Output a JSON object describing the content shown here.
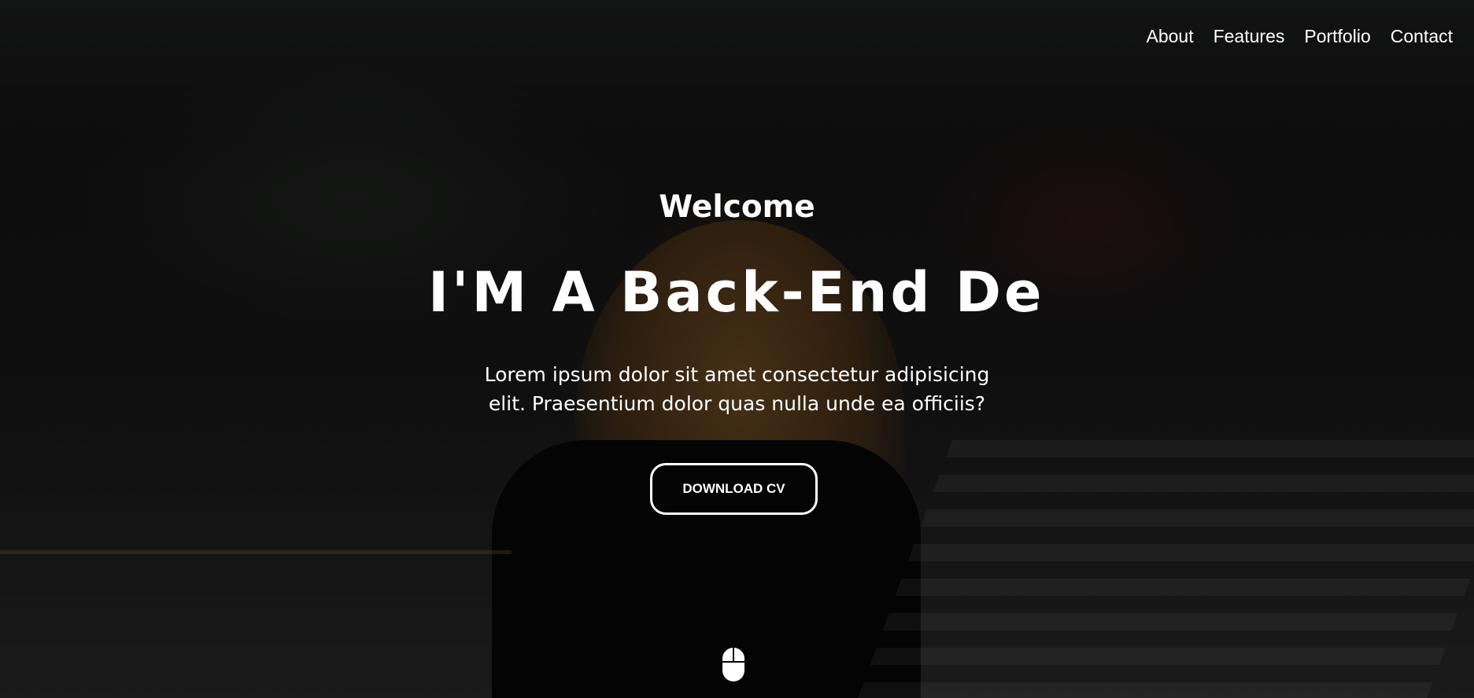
{
  "nav": {
    "items": [
      {
        "label": "About"
      },
      {
        "label": "Features"
      },
      {
        "label": "Portfolio"
      },
      {
        "label": "Contact"
      }
    ]
  },
  "hero": {
    "welcome": "Welcome",
    "headline": "I'M A Back-End Devel",
    "description": "Lorem ipsum dolor sit amet consectetur adipisicing elit. Praesentium dolor quas nulla unde ea officiis?",
    "cta_label": "DOWNLOAD CV",
    "scroll_icon": "mouse-icon"
  },
  "colors": {
    "text": "#ffffff",
    "background": "#0d0d0d"
  }
}
